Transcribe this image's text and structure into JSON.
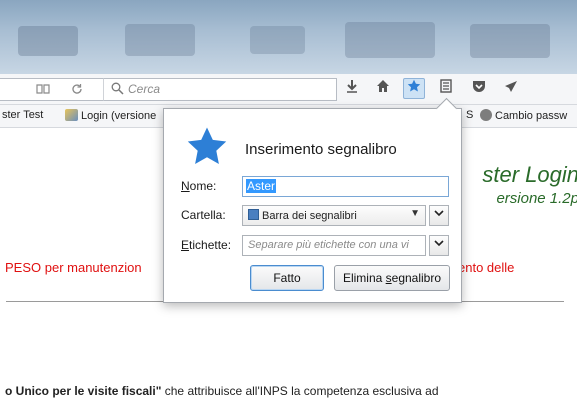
{
  "navbar": {
    "search_placeholder": "Cerca"
  },
  "bookmarks": {
    "item1": "ster Test",
    "item2": "Login (versione",
    "item3": "S",
    "item4": "Cambio passw"
  },
  "page": {
    "heading1": "ster Login",
    "heading2": "ersione 1.2p",
    "red_left": "PESO per manutenzion",
    "red_right": "ento delle",
    "bottom_bold": "o Unico per le visite fiscali\"",
    "bottom_rest": " che attribuisce all'INPS la competenza esclusiva ad"
  },
  "popup": {
    "title": "Inserimento segnalibro",
    "name_label_u": "N",
    "name_label_rest": "ome:",
    "name_value": "Aster",
    "folder_label": "Cartella:",
    "folder_value": "Barra dei segnalibri",
    "tags_label_u": "E",
    "tags_label_rest": "tichette:",
    "tags_placeholder": "Separare più etichette con una vi",
    "done_button": "Fatto",
    "remove_button_pre": "Elimina ",
    "remove_button_u": "s",
    "remove_button_post": "egnalibro"
  },
  "colors": {
    "accent_blue": "#2d7fd6",
    "heading_green": "#2a6b2a",
    "warning_red": "#e01010"
  }
}
